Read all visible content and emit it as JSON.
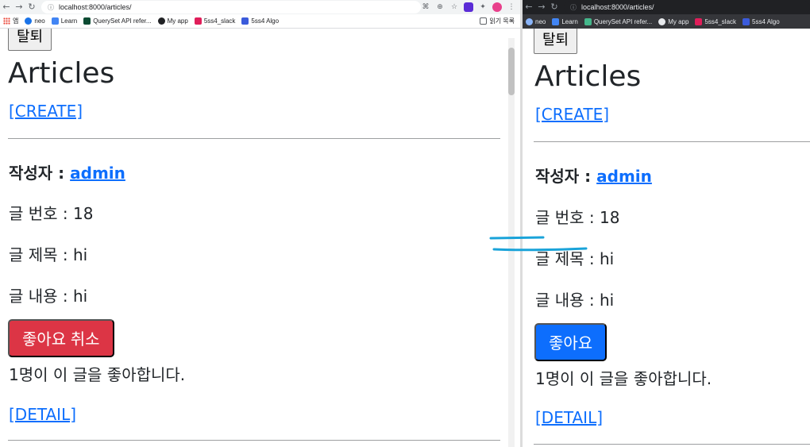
{
  "left_window": {
    "url": "localhost:8000/articles/",
    "bookmarks": [
      "앱",
      "neo",
      "Learn",
      "QuerySet API refer...",
      "My app",
      "5ss4_slack",
      "5ss4 Algo"
    ],
    "reading_list": "읽기 목록",
    "leave_button": "탈퇴",
    "heading": "Articles",
    "create_link": "[CREATE]",
    "author_label": "작성자 : ",
    "author": "admin",
    "number_line": "글 번호 : 18",
    "title_line": "글 제목 : hi",
    "content_line": "글 내용 : hi",
    "like_button": "좋아요 취소",
    "like_count": "1명이 이 글을 좋아합니다.",
    "detail_link": "[DETAIL]"
  },
  "right_window": {
    "url": "localhost:8000/articles/",
    "bookmarks": [
      "neo",
      "Learn",
      "QuerySet API refer...",
      "My app",
      "5ss4_slack",
      "5ss4 Algo"
    ],
    "leave_button": "탈퇴",
    "heading": "Articles",
    "create_link": "[CREATE]",
    "author_label": "작성자 : ",
    "author": "admin",
    "number_line": "글 번호 : 18",
    "title_line": "글 제목 : hi",
    "content_line": "글 내용 : hi",
    "like_button": "좋아요",
    "like_count": "1명이 이 글을 좋아합니다.",
    "detail_link": "[DETAIL]"
  },
  "colors": {
    "danger": "#dc3545",
    "primary": "#0d6efd",
    "link": "#0d6efd",
    "annotation": "#1aa3d9"
  }
}
